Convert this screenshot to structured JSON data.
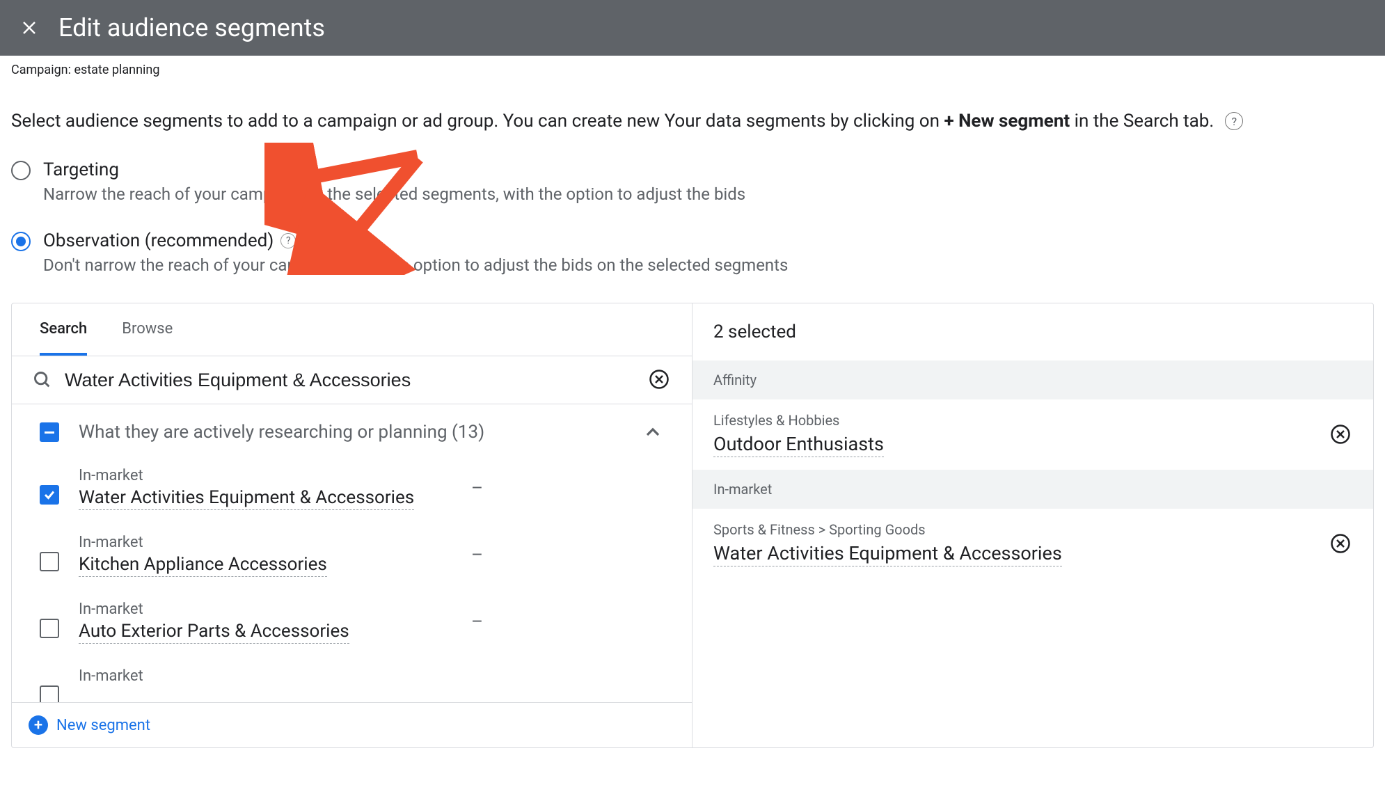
{
  "header": {
    "title": "Edit audience segments"
  },
  "breadcrumb": "Campaign: estate planning",
  "description": {
    "pre": "Select audience segments to add to a campaign or ad group. You can create new Your data segments by clicking on ",
    "bold": "+ New segment",
    "post": " in the Search tab."
  },
  "radios": {
    "targeting": {
      "title": "Targeting",
      "sub": "Narrow the reach of your campaign to the selected segments, with the option to adjust the bids"
    },
    "observation": {
      "title": "Observation (recommended)",
      "sub": "Don't narrow the reach of your campaign, with the option to adjust the bids on the selected segments"
    }
  },
  "tabs": {
    "search": "Search",
    "browse": "Browse"
  },
  "search": {
    "value": "Water Activities Equipment & Accessories"
  },
  "group": {
    "label": "What they are actively researching or planning (13)"
  },
  "items": [
    {
      "category": "In-market",
      "name": "Water Activities Equipment & Accessories",
      "checked": true,
      "indicator": "–"
    },
    {
      "category": "In-market",
      "name": "Kitchen Appliance Accessories",
      "checked": false,
      "indicator": "–"
    },
    {
      "category": "In-market",
      "name": "Auto Exterior Parts & Accessories",
      "checked": false,
      "indicator": "–"
    },
    {
      "category": "In-market",
      "name": "",
      "checked": false,
      "indicator": ""
    }
  ],
  "new_segment": "New segment",
  "selected": {
    "count_label": "2 selected",
    "sections": [
      {
        "header": "Affinity",
        "items": [
          {
            "path": "Lifestyles & Hobbies",
            "name": "Outdoor Enthusiasts"
          }
        ]
      },
      {
        "header": "In-market",
        "items": [
          {
            "path": "Sports & Fitness > Sporting Goods",
            "name": "Water Activities Equipment & Accessories"
          }
        ]
      }
    ]
  }
}
